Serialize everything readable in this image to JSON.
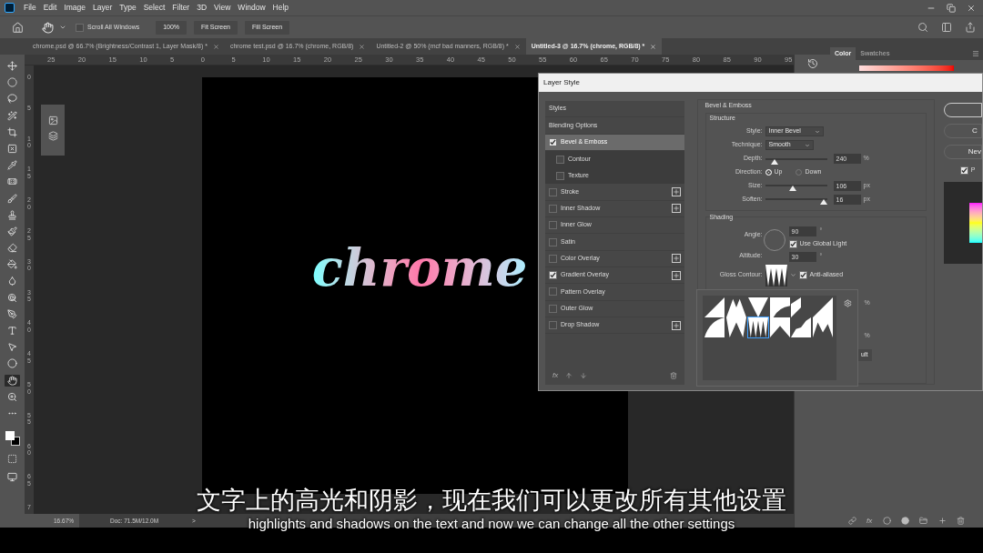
{
  "menu": [
    "File",
    "Edit",
    "Image",
    "Layer",
    "Type",
    "Select",
    "Filter",
    "3D",
    "View",
    "Window",
    "Help"
  ],
  "options_bar": {
    "scroll_all_windows": {
      "label": "Scroll All Windows",
      "checked": false
    },
    "buttons": [
      "100%",
      "Fit Screen",
      "Fill Screen"
    ]
  },
  "document_tabs": [
    {
      "label": "chrome.psd @ 66.7% (Brightness/Contrast 1, Layer Mask/8) *",
      "selected": false
    },
    {
      "label": "chrome test.psd @ 16.7% (chrome, RGB/8)",
      "selected": false
    },
    {
      "label": "Untitled-2 @ 50% (mcf bad manners, RGB/8) *",
      "selected": false
    },
    {
      "label": "Untitled-3 @ 16.7% (chrome, RGB/8) *",
      "selected": true
    }
  ],
  "toolbar": {
    "tools": [
      {
        "selected": false
      },
      {
        "selected": false
      },
      {
        "selected": false
      },
      {
        "selected": false
      },
      {
        "selected": false
      },
      {
        "selected": false
      },
      {
        "selected": false
      },
      {
        "selected": false
      },
      {
        "selected": false
      },
      {
        "selected": false
      },
      {
        "selected": false
      },
      {
        "selected": false
      },
      {
        "selected": false
      },
      {
        "selected": false
      },
      {
        "selected": false
      },
      {
        "selected": false
      },
      {
        "selected": false
      },
      {
        "selected": false
      },
      {
        "selected": false
      },
      {
        "selected": true
      },
      {
        "selected": false
      },
      {
        "selected": false
      }
    ]
  },
  "horizontal_ruler": [
    "25",
    "20",
    "15",
    "10",
    "5",
    "0",
    "5",
    "10",
    "15",
    "20",
    "25",
    "30",
    "35",
    "40",
    "45",
    "50",
    "55",
    "60",
    "65",
    "70",
    "75",
    "80",
    "85",
    "90",
    "95"
  ],
  "vertical_ruler": [
    "0",
    "5",
    "10",
    "15",
    "20",
    "25",
    "30",
    "35",
    "40",
    "45",
    "50",
    "55",
    "60",
    "65",
    "7"
  ],
  "canvas_text": "chrome",
  "status_bar": {
    "zoom": "16.67%",
    "doc": "Doc: 71.5M/12.0M",
    "arrow": ">"
  },
  "layers_panel": {
    "fx_label": "fx"
  },
  "right_panel": {
    "tabs": [
      {
        "label": "Color",
        "selected": true
      },
      {
        "label": "Swatches",
        "selected": false
      }
    ]
  },
  "layer_style": {
    "title": "Layer Style",
    "styles": [
      {
        "kind": "header",
        "label": "Styles",
        "selected": false
      },
      {
        "kind": "header",
        "label": "Blending Options",
        "selected": false
      },
      {
        "kind": "effect",
        "label": "Bevel & Emboss",
        "checked": true,
        "selected": true,
        "plus": false,
        "children": [
          {
            "label": "Contour",
            "checked": false
          },
          {
            "label": "Texture",
            "checked": false
          }
        ]
      },
      {
        "kind": "effect",
        "label": "Stroke",
        "checked": false,
        "selected": false,
        "plus": true
      },
      {
        "kind": "effect",
        "label": "Inner Shadow",
        "checked": false,
        "selected": false,
        "plus": true
      },
      {
        "kind": "effect",
        "label": "Inner Glow",
        "checked": false,
        "selected": false,
        "plus": false
      },
      {
        "kind": "effect",
        "label": "Satin",
        "checked": false,
        "selected": false,
        "plus": false
      },
      {
        "kind": "effect",
        "label": "Color Overlay",
        "checked": false,
        "selected": false,
        "plus": true
      },
      {
        "kind": "effect",
        "label": "Gradient Overlay",
        "checked": true,
        "selected": false,
        "plus": true
      },
      {
        "kind": "effect",
        "label": "Pattern Overlay",
        "checked": false,
        "selected": false,
        "plus": false
      },
      {
        "kind": "effect",
        "label": "Outer Glow",
        "checked": false,
        "selected": false,
        "plus": false
      },
      {
        "kind": "effect",
        "label": "Drop Shadow",
        "checked": false,
        "selected": false,
        "plus": true
      }
    ],
    "fx_label": "fx",
    "section_title": "Bevel & Emboss",
    "structure": {
      "title": "Structure",
      "style": {
        "label": "Style:",
        "value": "Inner Bevel"
      },
      "technique": {
        "label": "Technique:",
        "value": "Smooth"
      },
      "depth": {
        "label": "Depth:",
        "level": 0.15,
        "value": "240",
        "unit": "%"
      },
      "direction": {
        "label": "Direction:",
        "options": [
          {
            "label": "Up",
            "selected": true
          },
          {
            "label": "Down",
            "selected": false
          }
        ]
      },
      "size": {
        "label": "Size:",
        "level": 0.45,
        "value": "106",
        "unit": "px"
      },
      "soften": {
        "label": "Soften:",
        "level": 0.95,
        "value": "16",
        "unit": "px"
      }
    },
    "shading": {
      "title": "Shading",
      "angle": {
        "label": "Angle:",
        "value": "90",
        "unit": "°"
      },
      "global_light": {
        "label": "Use Global Light",
        "checked": true
      },
      "altitude": {
        "label": "Altitude:",
        "value": "30",
        "unit": "°"
      },
      "gloss_contour": {
        "label": "Gloss Contour:"
      },
      "anti_aliased": {
        "label": "Anti-aliased",
        "checked": true
      },
      "hidden_units": [
        "%",
        "%"
      ],
      "default_button": "ult"
    },
    "buttons": [
      "C",
      "Nev"
    ],
    "preview": {
      "label": "P",
      "checked": true
    },
    "contour_picker": [
      {
        "selected": false
      },
      {
        "selected": false
      },
      {
        "selected": false
      },
      {
        "selected": false
      },
      {
        "selected": false
      },
      {
        "selected": false
      },
      {
        "selected": false
      },
      {
        "selected": false
      },
      {
        "selected": true
      },
      {
        "selected": false
      },
      {
        "selected": false
      },
      {
        "selected": false
      }
    ]
  },
  "subtitles": {
    "chinese": "文字上的高光和阴影，现在我们可以更改所有其他设置",
    "english": "highlights and shadows on the text and now we can change all the other settings"
  }
}
